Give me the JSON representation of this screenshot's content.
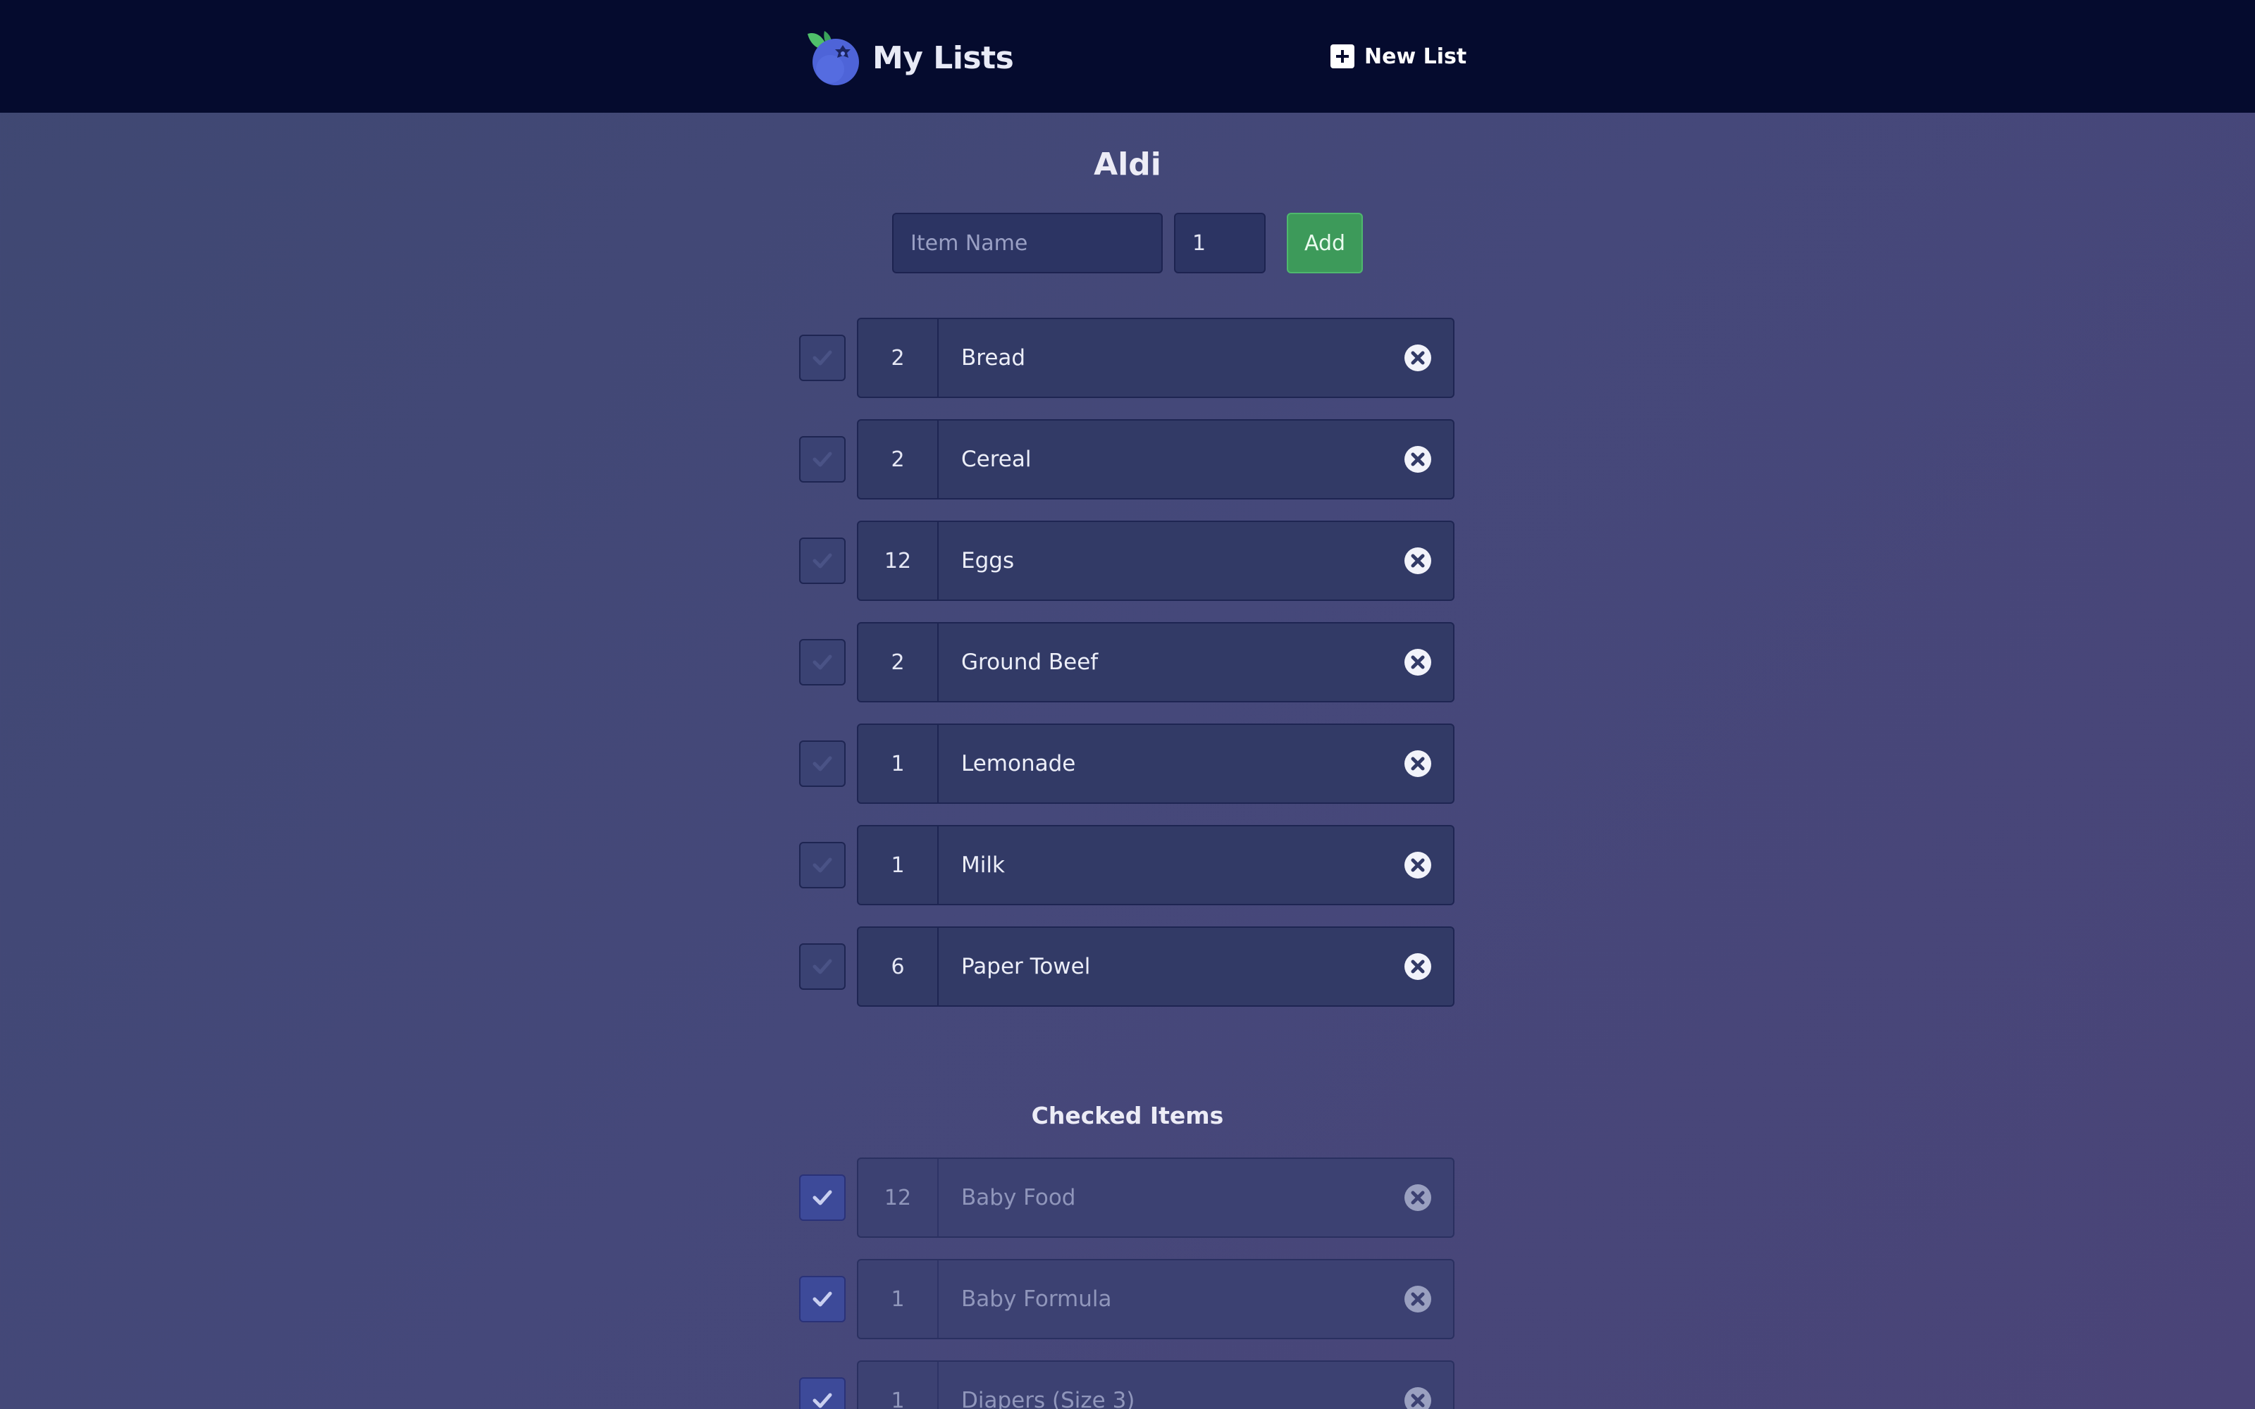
{
  "header": {
    "brand_title": "My Lists",
    "new_list_label": "New List",
    "background": "#050b2e"
  },
  "list": {
    "title": "Aldi",
    "form": {
      "name_placeholder": "Item Name",
      "quantity_value": "1",
      "add_label": "Add"
    },
    "unchecked_items": [
      {
        "qty": "2",
        "name": "Bread"
      },
      {
        "qty": "2",
        "name": "Cereal"
      },
      {
        "qty": "12",
        "name": "Eggs"
      },
      {
        "qty": "2",
        "name": "Ground Beef"
      },
      {
        "qty": "1",
        "name": "Lemonade"
      },
      {
        "qty": "1",
        "name": "Milk"
      },
      {
        "qty": "6",
        "name": "Paper Towel"
      }
    ],
    "checked_title": "Checked Items",
    "checked_items": [
      {
        "qty": "12",
        "name": "Baby Food"
      },
      {
        "qty": "1",
        "name": "Baby Formula"
      },
      {
        "qty": "1",
        "name": "Diapers (Size 3)"
      }
    ]
  },
  "icons": {
    "logo": "blueberry-logo-icon",
    "new_list": "plus-square-icon",
    "check": "checkmark-icon",
    "delete": "close-circle-icon"
  },
  "colors": {
    "accent_green": "#3d9a5a",
    "checked_box": "#3d4a99"
  }
}
